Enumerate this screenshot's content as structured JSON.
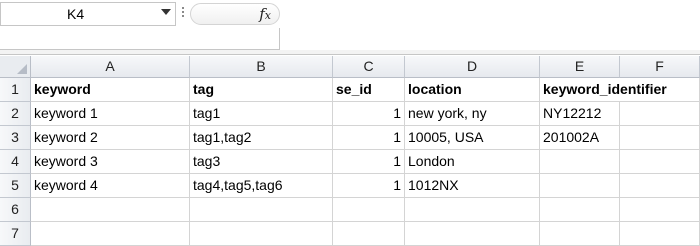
{
  "formula_bar": {
    "name_box": "K4",
    "fx_label": "fx",
    "formula_value": ""
  },
  "sheet": {
    "columns": [
      "A",
      "B",
      "C",
      "D",
      "E",
      "F"
    ],
    "rows": [
      "1",
      "2",
      "3",
      "4",
      "5",
      "6",
      "7"
    ],
    "cells": [
      [
        "keyword",
        "tag",
        "se_id",
        "location",
        "keyword_identifier",
        ""
      ],
      [
        "keyword 1",
        "tag1",
        "1",
        "new york, ny",
        "NY12212",
        ""
      ],
      [
        "keyword 2",
        "tag1,tag2",
        "1",
        "10005, USA",
        "201002A",
        ""
      ],
      [
        "keyword 3",
        "tag3",
        "1",
        "London",
        "",
        ""
      ],
      [
        "keyword 4",
        "tag4,tag5,tag6",
        "1",
        "1012NX",
        "",
        ""
      ],
      [
        "",
        "",
        "",
        "",
        "",
        ""
      ],
      [
        "",
        "",
        "",
        "",
        "",
        ""
      ]
    ]
  }
}
